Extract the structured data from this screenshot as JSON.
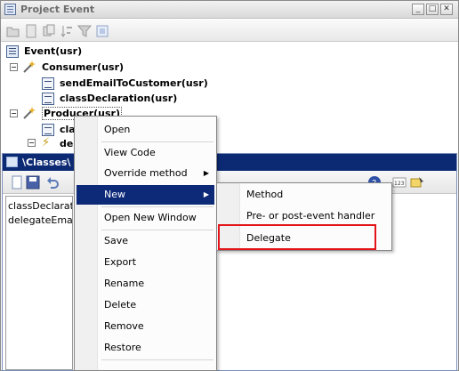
{
  "window1": {
    "title": "Project Event"
  },
  "tree": {
    "root": "Event(usr)",
    "consumer": "Consumer(usr)",
    "consumer_children": [
      "sendEmailToCustomer(usr)",
      "classDeclaration(usr)"
    ],
    "producer": "Producer(usr)",
    "producer_children_partial": [
      "cla",
      "del"
    ]
  },
  "window2": {
    "title": "\\Classes\\",
    "list_items": [
      "classDeclaratio",
      "delegateEmail"
    ]
  },
  "context_menu": {
    "items": [
      "Open",
      "View Code",
      "Override method",
      "New",
      "Open New Window",
      "Save",
      "Export",
      "Rename",
      "Delete",
      "Remove",
      "Restore"
    ],
    "selected": "New"
  },
  "submenu": {
    "items": [
      "Method",
      "Pre- or post-event handler",
      "Delegate"
    ],
    "highlighted": "Delegate"
  },
  "colors": {
    "selection": "#0d2a78",
    "highlight_box": "#e3141a",
    "titlebar2": "#0c2a74"
  }
}
